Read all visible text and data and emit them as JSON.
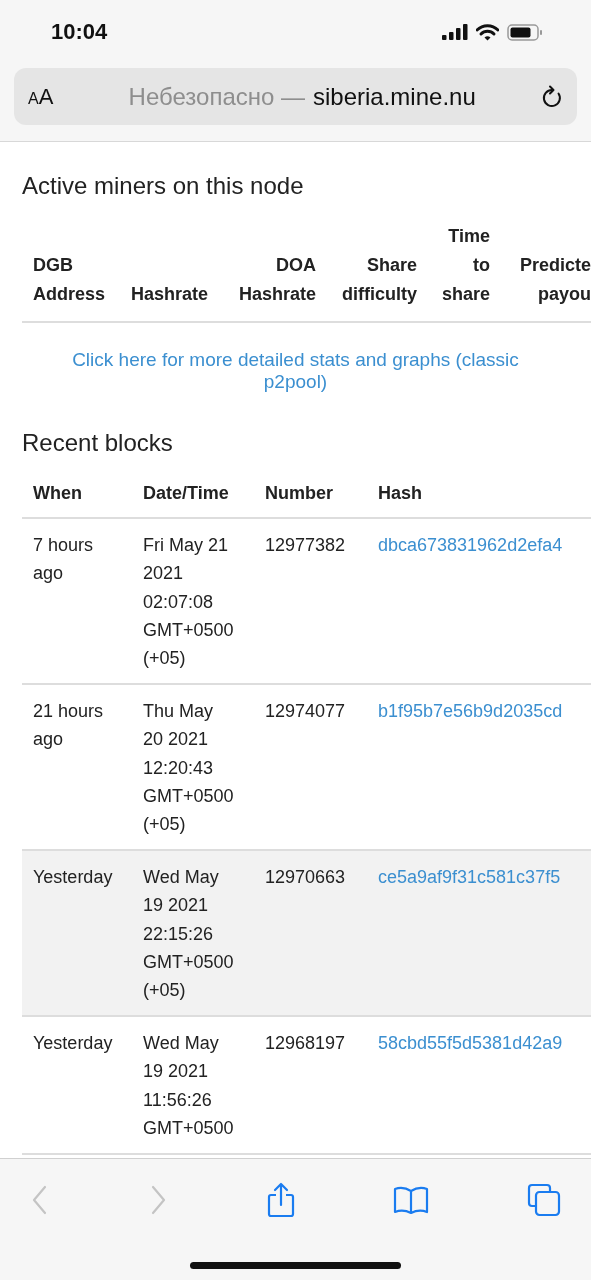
{
  "status_bar": {
    "time": "10:04"
  },
  "address_bar": {
    "text_size": "AA",
    "security_label": "Небезопасно —",
    "host": "siberia.mine.nu"
  },
  "miners": {
    "title": "Active miners on this node",
    "columns": [
      "DGB Address",
      "Hashrate",
      "DOA Hashrate",
      "Share difficulty",
      "Time to share",
      "Predicte payou"
    ],
    "link": "Click here for more detailed stats and graphs (classic p2pool)"
  },
  "recent_blocks": {
    "title": "Recent blocks",
    "columns": [
      "When",
      "Date/Time",
      "Number",
      "Hash"
    ],
    "rows": [
      {
        "when": "7 hours ago",
        "datetime": "Fri May 21 2021 02:07:08 GMT+0500 (+05)",
        "number": "12977382",
        "hash": "dbca673831962d2efa4",
        "selected": false
      },
      {
        "when": "21 hours ago",
        "datetime": "Thu May 20 2021 12:20:43 GMT+0500 (+05)",
        "number": "12974077",
        "hash": "b1f95b7e56b9d2035cd",
        "selected": false
      },
      {
        "when": "Yesterday",
        "datetime": "Wed May 19 2021 22:15:26 GMT+0500 (+05)",
        "number": "12970663",
        "hash": "ce5a9af9f31c581c37f5",
        "selected": true
      },
      {
        "when": "Yesterday",
        "datetime": "Wed May 19 2021 11:56:26 GMT+0500",
        "number": "12968197",
        "hash": "58cbd55f5d5381d42a9",
        "selected": false
      }
    ]
  },
  "toolbar": {
    "back_enabled": false,
    "forward_enabled": false
  }
}
